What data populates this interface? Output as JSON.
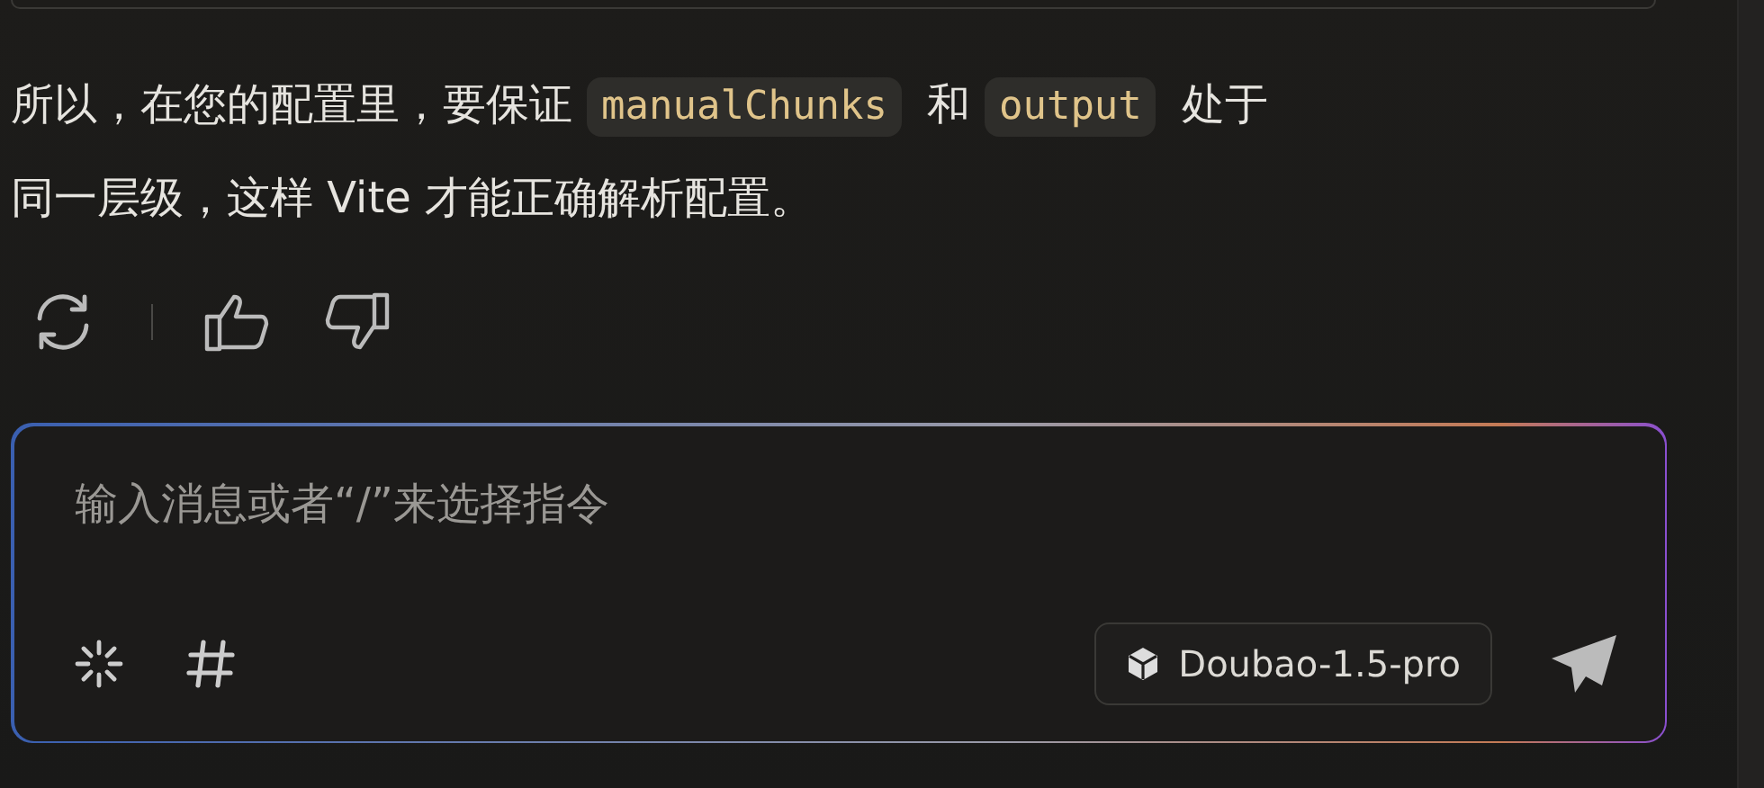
{
  "message": {
    "segments": [
      {
        "kind": "text",
        "text": "所以，在您的配置里，要保证"
      },
      {
        "kind": "code",
        "text": "manualChunks"
      },
      {
        "kind": "text",
        "text": "和"
      },
      {
        "kind": "code",
        "text": "output"
      },
      {
        "kind": "text",
        "text": "处于"
      },
      {
        "kind": "text",
        "text": "同一层级，这样 Vite 才能正确解析配置。"
      }
    ]
  },
  "composer": {
    "placeholder": "输入消息或者“/”来选择指令",
    "model": "Doubao-1.5-pro"
  }
}
